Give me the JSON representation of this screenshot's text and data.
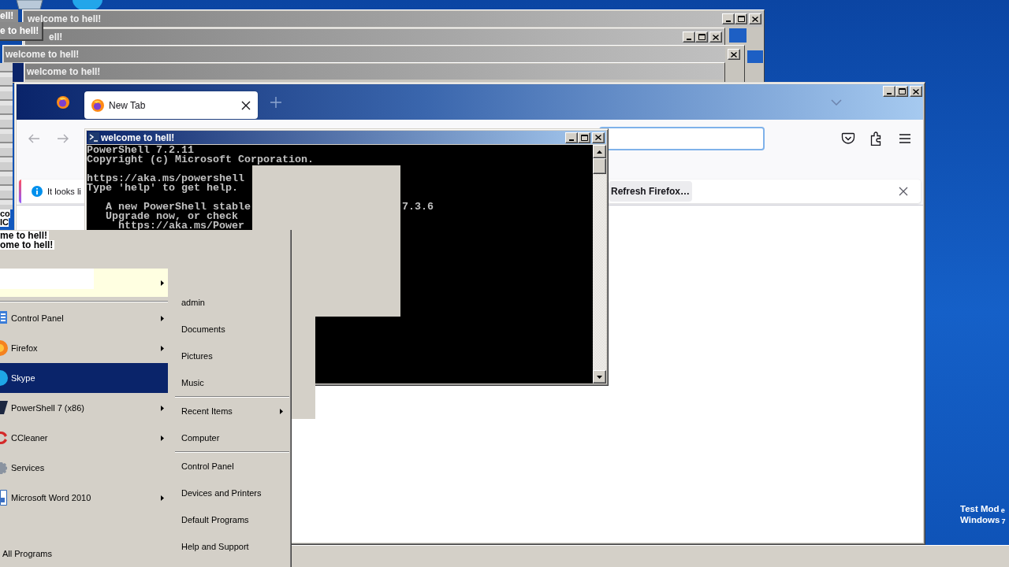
{
  "ghost_windows": [
    {
      "title": "welcome to hell!",
      "kind": "full"
    },
    {
      "title": "ell!",
      "kind": "full"
    },
    {
      "title": "welcome to hell!",
      "kind": "close"
    },
    {
      "title": "welcome to hell!",
      "kind": "plain"
    }
  ],
  "title_fragments": [
    "ell!",
    "e to hell!"
  ],
  "edge_fragments": [
    "co",
    "IC"
  ],
  "firefox": {
    "tabs": [
      {
        "label": "New Tab",
        "selected": true
      }
    ],
    "notification": {
      "text": "It looks li",
      "button": "Refresh Firefox…"
    }
  },
  "powershell": {
    "title": "welcome to hell!",
    "paragraphs": [
      [
        "PowerShell 7.2.11",
        "Copyright (c) Microsoft Corporation."
      ],
      [
        "https://aka.ms/powershell",
        "Type 'help' to get help."
      ],
      [
        "A new PowerShell stable",
        "Upgrade now, or check",
        "https://aka.ms/Power"
      ]
    ],
    "line_end": "7.3.6"
  },
  "start_menu": {
    "fragments": [
      "me to hell!",
      "ome to hell!"
    ],
    "banner": {
      "submenu": true
    },
    "programs": [
      {
        "label": "Control Panel",
        "selected": false,
        "submenu": true
      },
      {
        "label": "Firefox",
        "selected": false,
        "submenu": true
      },
      {
        "label": "Skype",
        "selected": true,
        "submenu": false
      },
      {
        "label": "PowerShell 7 (x86)",
        "selected": false,
        "submenu": true
      },
      {
        "label": "CCleaner",
        "selected": false,
        "submenu": true
      },
      {
        "label": "Services",
        "selected": false,
        "submenu": false
      },
      {
        "label": "Microsoft Word 2010",
        "selected": false,
        "submenu": true
      }
    ],
    "all_programs": "All Programs",
    "places": [
      [
        {
          "label": "admin",
          "submenu": false
        },
        {
          "label": "Documents",
          "submenu": false
        },
        {
          "label": "Pictures",
          "submenu": false
        },
        {
          "label": "Music",
          "submenu": false
        }
      ],
      [
        {
          "label": "Recent Items",
          "submenu": true
        },
        {
          "label": "Computer",
          "submenu": false
        }
      ],
      [
        {
          "label": "Control Panel",
          "submenu": false
        },
        {
          "label": "Devices and Printers",
          "submenu": false
        },
        {
          "label": "Default Programs",
          "submenu": false
        },
        {
          "label": "Help and Support",
          "submenu": false
        }
      ]
    ]
  },
  "desktop_notice": [
    {
      "text": "Test Mod",
      "tail": "e"
    },
    {
      "text": "Windows",
      "tail": "7"
    }
  ]
}
